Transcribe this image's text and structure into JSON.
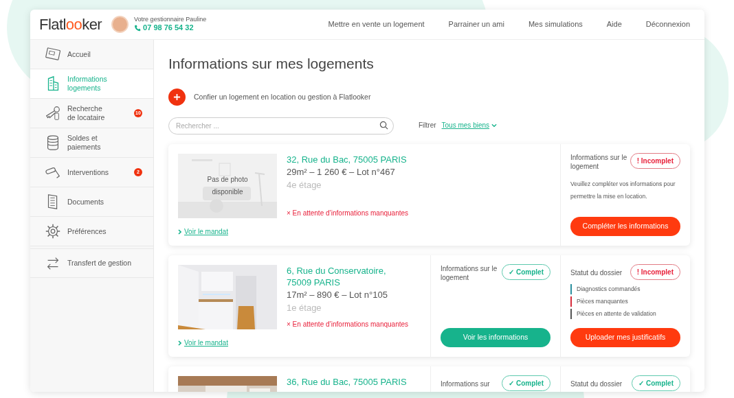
{
  "header": {
    "logo": [
      {
        "text": "Flatl",
        "accent": false
      },
      {
        "text": "oo",
        "accent": true
      },
      {
        "text": "ker",
        "accent": false
      }
    ],
    "manager": {
      "label": "Votre gestionnaire Pauline",
      "phone": "07 98 76 54 32"
    },
    "nav": [
      "Mettre en vente un logement",
      "Parrainer un ami",
      "Mes simulations",
      "Aide",
      "Déconnexion"
    ]
  },
  "sidebar": {
    "items": [
      {
        "label": "Accueil",
        "kind": "screen",
        "selected": false
      },
      {
        "label": "Informations logements",
        "kind": "building",
        "selected": true
      },
      {
        "label": "Recherche de locataire",
        "kind": "keys",
        "selected": false,
        "badge": "10"
      },
      {
        "label": "Soldes et paiements",
        "kind": "coins",
        "selected": false
      },
      {
        "label": "Interventions",
        "kind": "roller",
        "selected": false,
        "badge": "2"
      },
      {
        "label": "Documents",
        "kind": "document",
        "selected": false
      },
      {
        "label": "Préférences",
        "kind": "gear",
        "selected": false
      },
      {
        "label": "Transfert de gestion",
        "kind": "transfer",
        "selected": false,
        "separated": true
      }
    ]
  },
  "page": {
    "title": "Informations sur mes logements",
    "add_action": "Confier un logement en location ou gestion à Flatlooker",
    "search": {
      "placeholder": "Rechercher ..."
    },
    "filter": {
      "label": "Filtrer",
      "value": "Tous mes biens"
    }
  },
  "properties": [
    {
      "photo": {
        "kind": "placeholder",
        "text": "Pas de photo disponible"
      },
      "address": "32, Rue du Bac, 75005 PARIS",
      "details": "29m² – 1 260 € – Lot n°467",
      "floor": "4e étage",
      "warning": "× En attente d’informations manquantes",
      "link": "Voir le mandat",
      "panels": [
        {
          "title": "Informations sur le logement",
          "status": {
            "kind": "incomplete",
            "label": "! Incomplet"
          },
          "message": "Veuillez compléter vos informations pour permettre la mise en location.",
          "button": {
            "label": "Compléter les informations",
            "kind": "danger"
          }
        }
      ]
    },
    {
      "photo": {
        "kind": "kitchen"
      },
      "address": "6, Rue du Conservatoire, 75009 PARIS",
      "details": "17m² – 890 € – Lot n°105",
      "floor": "1e étage",
      "warning": "× En attente d’informations manquantes",
      "link": "Voir le mandat",
      "panels": [
        {
          "title": "Informations sur le logement",
          "status": {
            "kind": "complete",
            "label": "✓ Complet"
          },
          "button": {
            "label": "Voir les informations",
            "kind": "primary"
          }
        },
        {
          "title": "Statut du dossier",
          "status": {
            "kind": "incomplete",
            "label": "! Incomplet"
          },
          "legend": [
            {
              "label": "Diagnostics commandés",
              "color": "#2a8f9e"
            },
            {
              "label": "Pièces manquantes",
              "color": "#d62b3a"
            },
            {
              "label": "Pièces en attente de validation",
              "color": "#555555"
            }
          ],
          "button": {
            "label": "Uploader mes justificatifs",
            "kind": "danger"
          }
        }
      ]
    },
    {
      "photo": {
        "kind": "room"
      },
      "address": "36, Rue du Bac, 75005 PARIS",
      "panels": [
        {
          "title": "Informations sur",
          "status": {
            "kind": "complete",
            "label": "✓ Complet"
          }
        },
        {
          "title": "Statut du dossier",
          "status": {
            "kind": "complete",
            "label": "✓ Complet"
          }
        }
      ]
    }
  ]
}
